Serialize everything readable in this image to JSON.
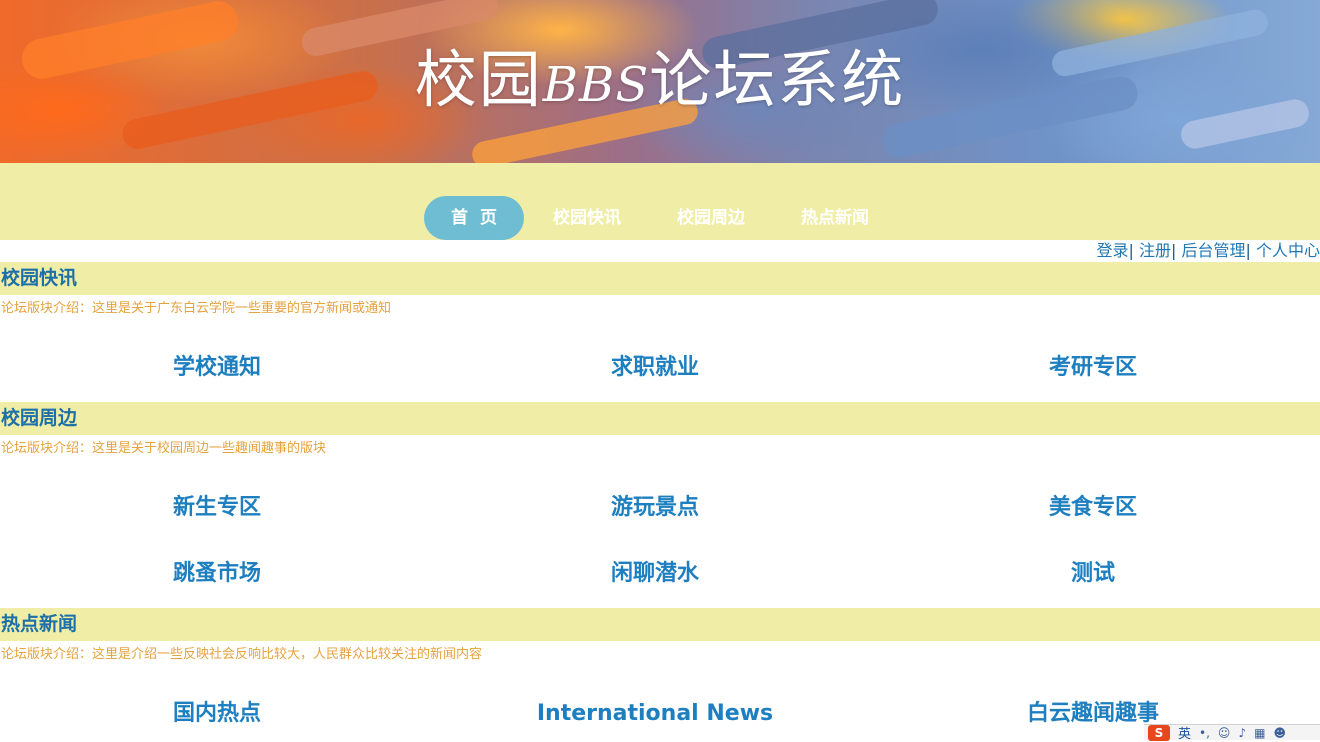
{
  "banner": {
    "title_part1": "校园",
    "title_part2": "BBS",
    "title_part3": "论坛系统"
  },
  "nav": {
    "items": [
      {
        "label": "首页"
      },
      {
        "label": "校园快讯"
      },
      {
        "label": "校园周边"
      },
      {
        "label": "热点新闻"
      }
    ],
    "active_index": 0
  },
  "user_links": {
    "login": "登录",
    "register": "注册",
    "admin": "后台管理",
    "profile": "个人中心",
    "separator": "|"
  },
  "sections": [
    {
      "title": "校园快讯",
      "intro": "论坛版块介绍：这里是关于广东白云学院一些重要的官方新闻或通知",
      "boards": [
        "学校通知",
        "求职就业",
        "考研专区"
      ]
    },
    {
      "title": "校园周边",
      "intro": "论坛版块介绍：这里是关于校园周边一些趣闻趣事的版块",
      "boards": [
        "新生专区",
        "游玩景点",
        "美食专区",
        "跳蚤市场",
        "闲聊潜水",
        "测试"
      ]
    },
    {
      "title": "热点新闻",
      "intro": "论坛版块介绍：这里是介绍一些反映社会反响比较大，人民群众比较关注的新闻内容",
      "boards": [
        "国内热点",
        "International News",
        "白云趣闻趣事"
      ]
    }
  ],
  "ime_toolbar": {
    "logo": "S",
    "mode": "英"
  },
  "colors": {
    "nav_background": "#f0eea6",
    "nav_active": "#6fbdd2",
    "board_link": "#1d7fbf",
    "intro_text": "#e6a23c"
  }
}
